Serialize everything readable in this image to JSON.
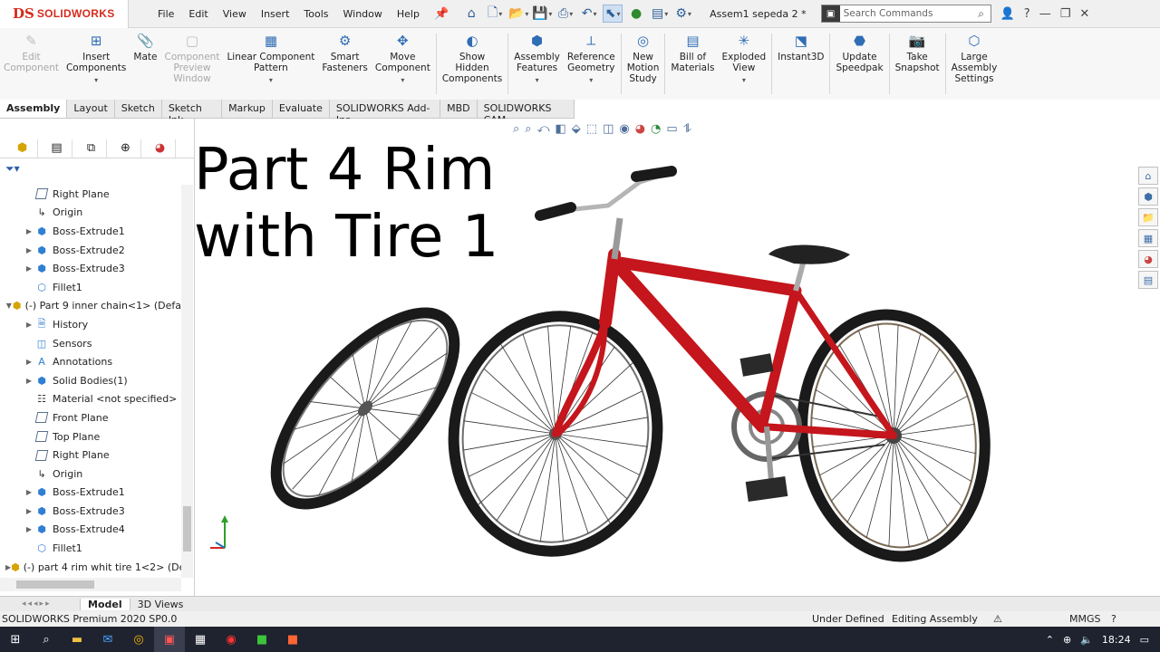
{
  "app": {
    "logo_prefix": "DS",
    "logo_name": "SOLIDWORKS",
    "doc_title": "Assem1 sepeda 2 *"
  },
  "menu": [
    "File",
    "Edit",
    "View",
    "Insert",
    "Tools",
    "Window",
    "Help"
  ],
  "search": {
    "placeholder": "Search Commands"
  },
  "ribbon": [
    {
      "label": "Edit\nComponent",
      "icon": "edit-component-icon",
      "disabled": true
    },
    {
      "label": "Insert\nComponents",
      "icon": "insert-components-icon",
      "disabled": false,
      "dropdown": true
    },
    {
      "label": "Mate",
      "icon": "mate-icon",
      "disabled": false
    },
    {
      "label": "Component\nPreview\nWindow",
      "icon": "component-preview-icon",
      "disabled": true
    },
    {
      "label": "Linear Component\nPattern",
      "icon": "linear-pattern-icon",
      "disabled": false,
      "dropdown": true
    },
    {
      "label": "Smart\nFasteners",
      "icon": "smart-fasteners-icon",
      "disabled": false
    },
    {
      "label": "Move\nComponent",
      "icon": "move-component-icon",
      "disabled": false,
      "dropdown": true
    },
    {
      "label": "Show\nHidden\nComponents",
      "icon": "show-hidden-icon",
      "disabled": false
    },
    {
      "label": "Assembly\nFeatures",
      "icon": "assembly-features-icon",
      "disabled": false,
      "dropdown": true
    },
    {
      "label": "Reference\nGeometry",
      "icon": "reference-geometry-icon",
      "disabled": false,
      "dropdown": true
    },
    {
      "label": "New\nMotion\nStudy",
      "icon": "motion-study-icon",
      "disabled": false
    },
    {
      "label": "Bill of\nMaterials",
      "icon": "bill-of-materials-icon",
      "disabled": false
    },
    {
      "label": "Exploded\nView",
      "icon": "exploded-view-icon",
      "disabled": false,
      "dropdown": true
    },
    {
      "label": "Instant3D",
      "icon": "instant3d-icon",
      "disabled": false
    },
    {
      "label": "Update\nSpeedpak",
      "icon": "speedpak-icon",
      "disabled": false
    },
    {
      "label": "Take\nSnapshot",
      "icon": "snapshot-icon",
      "disabled": false
    },
    {
      "label": "Large\nAssembly\nSettings",
      "icon": "large-assembly-icon",
      "disabled": false
    }
  ],
  "tabs": [
    "Assembly",
    "Layout",
    "Sketch",
    "Sketch Ink",
    "Markup",
    "Evaluate",
    "SOLIDWORKS Add-Ins",
    "MBD",
    "SOLIDWORKS CAM"
  ],
  "active_tab": "Assembly",
  "tree": [
    {
      "label": "Right Plane",
      "type": "plane",
      "indent": 2,
      "expand": ""
    },
    {
      "label": "Origin",
      "type": "origin",
      "indent": 2,
      "expand": ""
    },
    {
      "label": "Boss-Extrude1",
      "type": "feature",
      "indent": 2,
      "expand": "▶"
    },
    {
      "label": "Boss-Extrude2",
      "type": "feature",
      "indent": 2,
      "expand": "▶"
    },
    {
      "label": "Boss-Extrude3",
      "type": "feature",
      "indent": 2,
      "expand": "▶"
    },
    {
      "label": "Fillet1",
      "type": "fillet",
      "indent": 2,
      "expand": ""
    },
    {
      "label": "(-) Part 9 inner chain<1> (Defa",
      "type": "part",
      "indent": 1,
      "expand": "▼"
    },
    {
      "label": "History",
      "type": "history",
      "indent": 2,
      "expand": "▶"
    },
    {
      "label": "Sensors",
      "type": "sensors",
      "indent": 2,
      "expand": ""
    },
    {
      "label": "Annotations",
      "type": "annotations",
      "indent": 2,
      "expand": "▶"
    },
    {
      "label": "Solid Bodies(1)",
      "type": "bodies",
      "indent": 2,
      "expand": "▶"
    },
    {
      "label": "Material <not specified>",
      "type": "material",
      "indent": 2,
      "expand": ""
    },
    {
      "label": "Front Plane",
      "type": "plane",
      "indent": 2,
      "expand": ""
    },
    {
      "label": "Top Plane",
      "type": "plane",
      "indent": 2,
      "expand": ""
    },
    {
      "label": "Right Plane",
      "type": "plane",
      "indent": 2,
      "expand": ""
    },
    {
      "label": "Origin",
      "type": "origin",
      "indent": 2,
      "expand": ""
    },
    {
      "label": "Boss-Extrude1",
      "type": "feature",
      "indent": 2,
      "expand": "▶"
    },
    {
      "label": "Boss-Extrude3",
      "type": "feature",
      "indent": 2,
      "expand": "▶"
    },
    {
      "label": "Boss-Extrude4",
      "type": "feature",
      "indent": 2,
      "expand": "▶"
    },
    {
      "label": "Fillet1",
      "type": "fillet",
      "indent": 2,
      "expand": ""
    },
    {
      "label": "(-) part 4 rim whit tire 1<2> (De",
      "type": "part",
      "indent": 1,
      "expand": "▶"
    }
  ],
  "model_tabs": [
    "Model",
    "3D Views"
  ],
  "active_model_tab": "Model",
  "overlay_title": "Part 4 Rim\nwith Tire 1",
  "status": {
    "version": "SOLIDWORKS Premium 2020 SP0.0",
    "definition": "Under Defined",
    "mode": "Editing Assembly",
    "units": "MMGS"
  },
  "taskbar": {
    "time": "18:24"
  },
  "colors": {
    "frame": "#c4161c",
    "accent": "#d52b1e",
    "taskbar": "#1f2330"
  }
}
